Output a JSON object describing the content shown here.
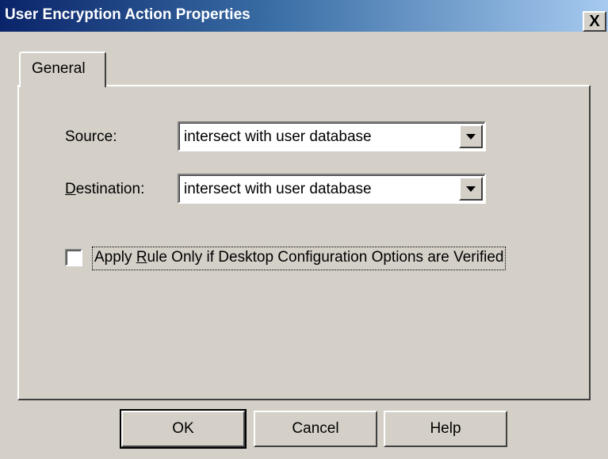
{
  "window": {
    "title": "User Encryption Action Properties",
    "close_glyph": "X",
    "close_icon": "close-icon"
  },
  "tabs": [
    {
      "label": "General",
      "active": true
    }
  ],
  "form": {
    "source": {
      "label": "Source:",
      "value": "intersect with user database"
    },
    "destination": {
      "label_access_key": "D",
      "label_rest": "estination:",
      "value": "intersect with user database"
    },
    "apply_rule": {
      "label_prefix": "Apply ",
      "label_access_key": "R",
      "label_rest": "ule Only if Desktop Configuration Options are Verified",
      "checked": false
    }
  },
  "buttons": {
    "ok": "OK",
    "cancel": "Cancel",
    "help": "Help"
  },
  "colors": {
    "titlebar_start": "#0a246a",
    "titlebar_end": "#a6caf0",
    "face": "#d4d0c8"
  }
}
